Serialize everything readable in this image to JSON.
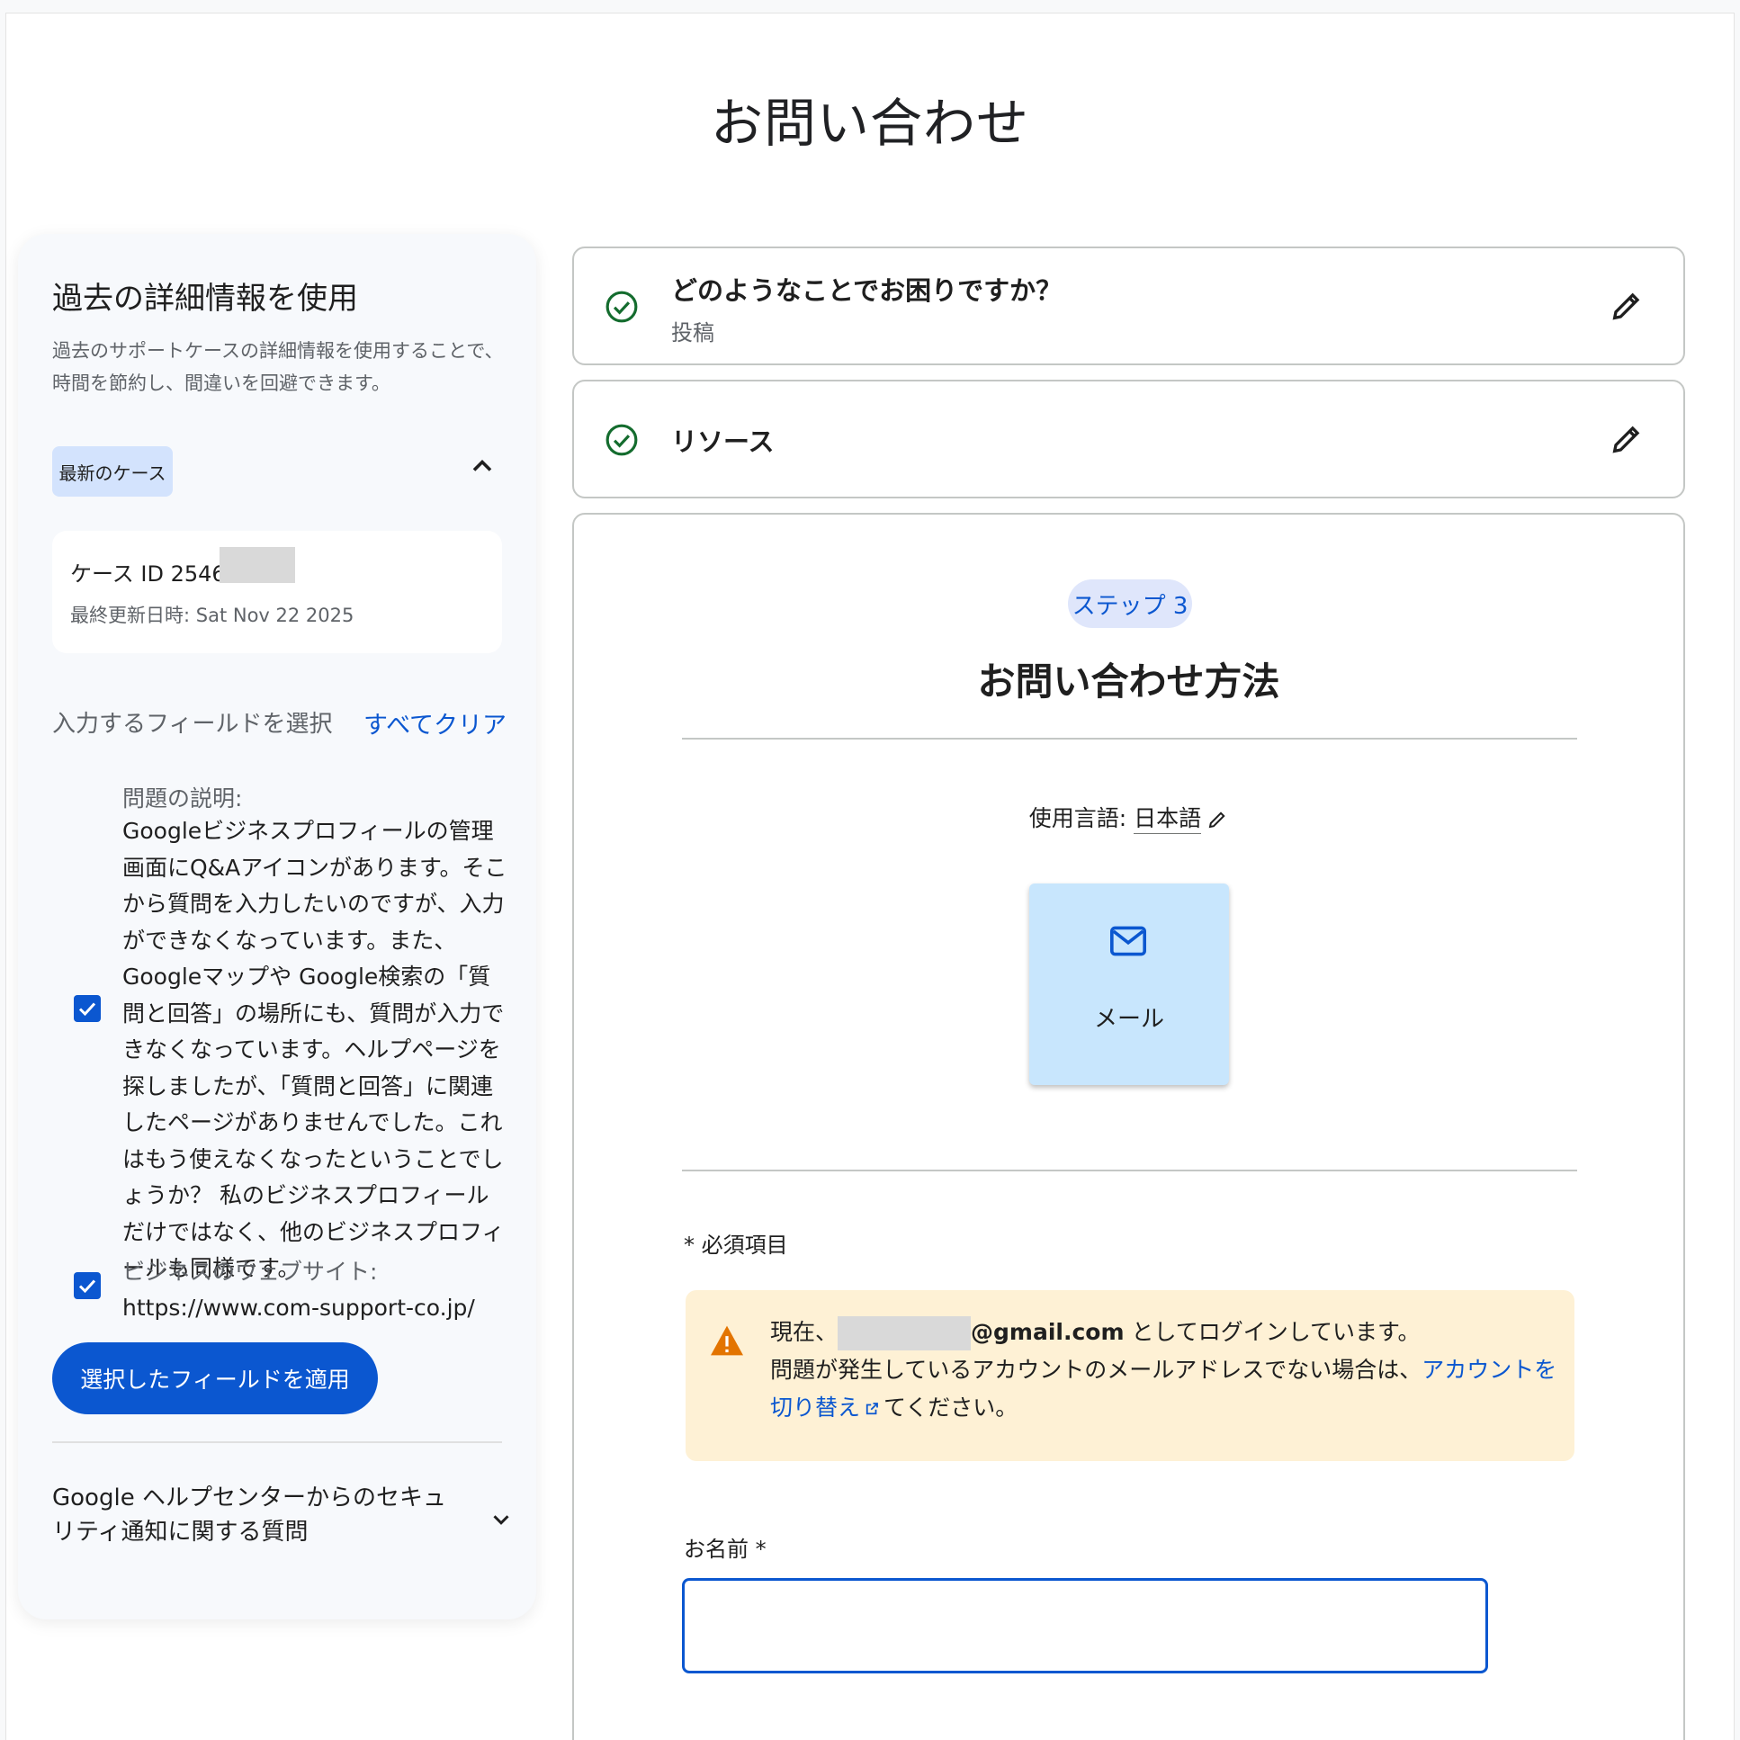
{
  "page": {
    "title": "お問い合わせ"
  },
  "left_panel": {
    "title": "過去の詳細情報を使用",
    "description": "過去のサポートケースの詳細情報を使用することで、時間を節約し、間違いを回避できます。",
    "latest_chip": "最新のケース",
    "case": {
      "id_label": "ケース ID 254669",
      "updated": "最終更新日時: Sat Nov 22 2025"
    },
    "field_select_label": "入力するフィールドを選択",
    "clear_all": "すべてクリア",
    "fields": [
      {
        "label": "問題の説明:",
        "value": "Googleビジネスプロフィールの管理画面にQ&Aアイコンがあります。そこから質問を入力したいのですが、入力ができなくなっています。また、Googleマップや Google検索の「質問と回答」の場所にも、質問が入力できなくなっています。ヘルプページを探しましたが、「質問と回答」に関連したページがありませんでした。これはもう使えなくなったということでしょうか？ 私のビジネスプロフィールだけではなく、他のビジネスプロフィールも同様です。",
        "checked": true
      },
      {
        "label": "ビジネスのウェブサイト:",
        "value": "https://www.com-support-co.jp/",
        "checked": true
      }
    ],
    "apply_button": "選択したフィールドを適用",
    "security_item": "Google ヘルプセンターからのセキュリティ通知に関する質問"
  },
  "steps": [
    {
      "title": "どのようなことでお困りですか？",
      "subtitle": "投稿",
      "completed": true
    },
    {
      "title": "リソース",
      "subtitle": "",
      "completed": true
    }
  ],
  "step3": {
    "chip": "ステップ 3",
    "title": "お問い合わせ方法",
    "language_label": "使用言語: ",
    "language_value": "日本語",
    "contact_option": {
      "label": "メール",
      "icon": "mail-icon"
    },
    "required_note": "* 必須項目",
    "warning": {
      "prefix": "現在、",
      "email_suffix": "@gmail.com",
      "logged_in": " としてログインしています。",
      "line2": "問題が発生しているアカウントのメールアドレスでない場合は、",
      "link": "アカウントを切り替え",
      "tail": "てください。"
    },
    "name_label": "お名前 *",
    "name_value": ""
  },
  "colors": {
    "accent": "#0b57d0",
    "success": "#146c2e",
    "warning_bg": "#fef1d5",
    "warning_icon": "#e37400"
  }
}
